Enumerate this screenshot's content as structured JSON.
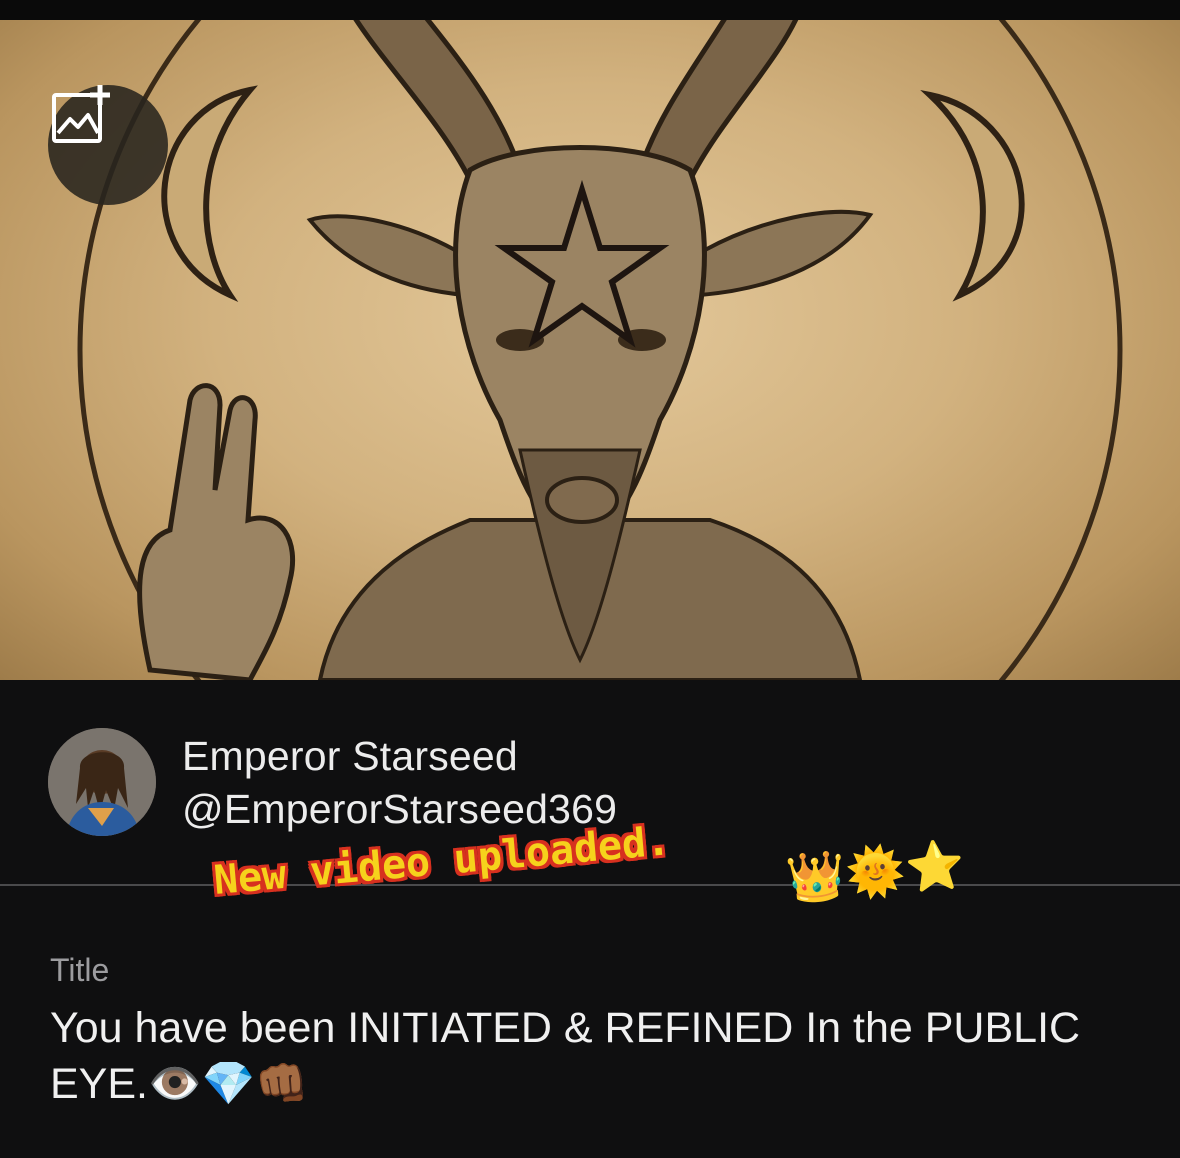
{
  "banner": {
    "add_image_icon": "image-add-icon"
  },
  "profile": {
    "display_name": "Emperor Starseed",
    "handle": "@EmperorStarseed369"
  },
  "overlay": {
    "text": "New video uploaded.",
    "emoji": "👑🌞⭐"
  },
  "title_field": {
    "label": "Title",
    "value": "You have been INITIATED & REFINED In the PUBLIC EYE.👁️💎👊🏾"
  },
  "colors": {
    "background": "#0f0f10",
    "text": "#f0f0f0",
    "label": "#9c9c9f",
    "overlay_fill": "#f6d21c",
    "overlay_outline": "#d7301f"
  }
}
